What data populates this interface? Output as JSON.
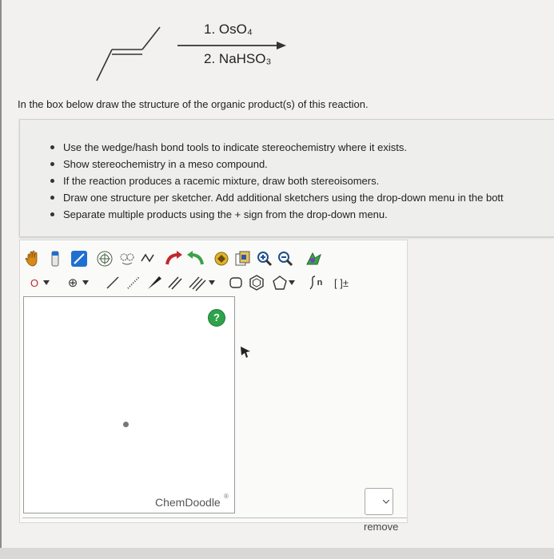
{
  "reaction": {
    "reagent_1": {
      "number": "1.",
      "formula": "OsO₄"
    },
    "reagent_2": {
      "number": "2.",
      "formula": "NaHSO₃"
    }
  },
  "question": {
    "prompt": "In the box below draw the structure of the organic product(s) of this reaction.",
    "instructions": [
      "Use the wedge/hash bond tools to indicate stereochemistry where it exists.",
      "Show stereochemistry in a meso compound.",
      "If the reaction produces a racemic mixture, draw both stereoisomers.",
      "Draw one structure per sketcher. Add additional sketchers using the drop-down menu in the bott",
      "Separate multiple products using the + sign from the drop-down menu."
    ]
  },
  "sketcher": {
    "atom_label": "O",
    "charge_symbol": "⊕",
    "help_label": "?",
    "brand": "ChemDoodle",
    "brand_mark": "®",
    "sn_label": "n",
    "bracket_label": "[ ]±",
    "icons": [
      "hand-icon",
      "eraser-icon",
      "marker-icon",
      "ring-template-icon",
      "lasso-icon",
      "chain-icon",
      "undo-icon",
      "redo-icon",
      "clean-icon",
      "copy-icon",
      "zoom-in-icon",
      "zoom-out-icon",
      "settings-icon"
    ]
  },
  "footer": {
    "remove_label": "remove",
    "plus_select_value": ""
  },
  "colors": {
    "help_green": "#2ea34a",
    "toolbar_blue": "#1e6fd0"
  }
}
